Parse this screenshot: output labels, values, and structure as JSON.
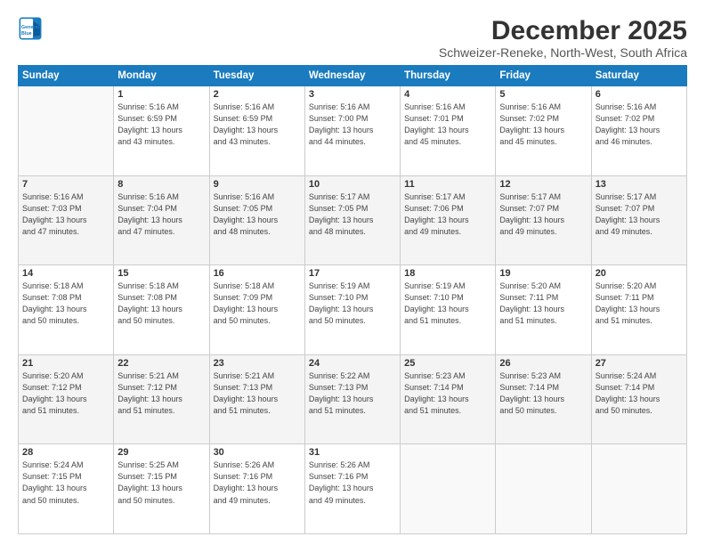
{
  "logo": {
    "line1": "General",
    "line2": "Blue"
  },
  "title": "December 2025",
  "subtitle": "Schweizer-Reneke, North-West, South Africa",
  "days_header": [
    "Sunday",
    "Monday",
    "Tuesday",
    "Wednesday",
    "Thursday",
    "Friday",
    "Saturday"
  ],
  "weeks": [
    [
      {
        "num": "",
        "sunrise": "",
        "sunset": "",
        "daylight": "",
        "empty": true
      },
      {
        "num": "1",
        "sunrise": "5:16 AM",
        "sunset": "6:59 PM",
        "hours": "13",
        "minutes": "43"
      },
      {
        "num": "2",
        "sunrise": "5:16 AM",
        "sunset": "6:59 PM",
        "hours": "13",
        "minutes": "43"
      },
      {
        "num": "3",
        "sunrise": "5:16 AM",
        "sunset": "7:00 PM",
        "hours": "13",
        "minutes": "44"
      },
      {
        "num": "4",
        "sunrise": "5:16 AM",
        "sunset": "7:01 PM",
        "hours": "13",
        "minutes": "45"
      },
      {
        "num": "5",
        "sunrise": "5:16 AM",
        "sunset": "7:02 PM",
        "hours": "13",
        "minutes": "45"
      },
      {
        "num": "6",
        "sunrise": "5:16 AM",
        "sunset": "7:02 PM",
        "hours": "13",
        "minutes": "46"
      }
    ],
    [
      {
        "num": "7",
        "sunrise": "5:16 AM",
        "sunset": "7:03 PM",
        "hours": "13",
        "minutes": "47"
      },
      {
        "num": "8",
        "sunrise": "5:16 AM",
        "sunset": "7:04 PM",
        "hours": "13",
        "minutes": "47"
      },
      {
        "num": "9",
        "sunrise": "5:16 AM",
        "sunset": "7:05 PM",
        "hours": "13",
        "minutes": "48"
      },
      {
        "num": "10",
        "sunrise": "5:17 AM",
        "sunset": "7:05 PM",
        "hours": "13",
        "minutes": "48"
      },
      {
        "num": "11",
        "sunrise": "5:17 AM",
        "sunset": "7:06 PM",
        "hours": "13",
        "minutes": "49"
      },
      {
        "num": "12",
        "sunrise": "5:17 AM",
        "sunset": "7:07 PM",
        "hours": "13",
        "minutes": "49"
      },
      {
        "num": "13",
        "sunrise": "5:17 AM",
        "sunset": "7:07 PM",
        "hours": "13",
        "minutes": "49"
      }
    ],
    [
      {
        "num": "14",
        "sunrise": "5:18 AM",
        "sunset": "7:08 PM",
        "hours": "13",
        "minutes": "50"
      },
      {
        "num": "15",
        "sunrise": "5:18 AM",
        "sunset": "7:08 PM",
        "hours": "13",
        "minutes": "50"
      },
      {
        "num": "16",
        "sunrise": "5:18 AM",
        "sunset": "7:09 PM",
        "hours": "13",
        "minutes": "50"
      },
      {
        "num": "17",
        "sunrise": "5:19 AM",
        "sunset": "7:10 PM",
        "hours": "13",
        "minutes": "50"
      },
      {
        "num": "18",
        "sunrise": "5:19 AM",
        "sunset": "7:10 PM",
        "hours": "13",
        "minutes": "51"
      },
      {
        "num": "19",
        "sunrise": "5:20 AM",
        "sunset": "7:11 PM",
        "hours": "13",
        "minutes": "51"
      },
      {
        "num": "20",
        "sunrise": "5:20 AM",
        "sunset": "7:11 PM",
        "hours": "13",
        "minutes": "51"
      }
    ],
    [
      {
        "num": "21",
        "sunrise": "5:20 AM",
        "sunset": "7:12 PM",
        "hours": "13",
        "minutes": "51"
      },
      {
        "num": "22",
        "sunrise": "5:21 AM",
        "sunset": "7:12 PM",
        "hours": "13",
        "minutes": "51"
      },
      {
        "num": "23",
        "sunrise": "5:21 AM",
        "sunset": "7:13 PM",
        "hours": "13",
        "minutes": "51"
      },
      {
        "num": "24",
        "sunrise": "5:22 AM",
        "sunset": "7:13 PM",
        "hours": "13",
        "minutes": "51"
      },
      {
        "num": "25",
        "sunrise": "5:23 AM",
        "sunset": "7:14 PM",
        "hours": "13",
        "minutes": "51"
      },
      {
        "num": "26",
        "sunrise": "5:23 AM",
        "sunset": "7:14 PM",
        "hours": "13",
        "minutes": "50"
      },
      {
        "num": "27",
        "sunrise": "5:24 AM",
        "sunset": "7:14 PM",
        "hours": "13",
        "minutes": "50"
      }
    ],
    [
      {
        "num": "28",
        "sunrise": "5:24 AM",
        "sunset": "7:15 PM",
        "hours": "13",
        "minutes": "50"
      },
      {
        "num": "29",
        "sunrise": "5:25 AM",
        "sunset": "7:15 PM",
        "hours": "13",
        "minutes": "50"
      },
      {
        "num": "30",
        "sunrise": "5:26 AM",
        "sunset": "7:16 PM",
        "hours": "13",
        "minutes": "49"
      },
      {
        "num": "31",
        "sunrise": "5:26 AM",
        "sunset": "7:16 PM",
        "hours": "13",
        "minutes": "49"
      },
      {
        "num": "",
        "sunrise": "",
        "sunset": "",
        "hours": "",
        "minutes": "",
        "empty": true
      },
      {
        "num": "",
        "sunrise": "",
        "sunset": "",
        "hours": "",
        "minutes": "",
        "empty": true
      },
      {
        "num": "",
        "sunrise": "",
        "sunset": "",
        "hours": "",
        "minutes": "",
        "empty": true
      }
    ]
  ]
}
